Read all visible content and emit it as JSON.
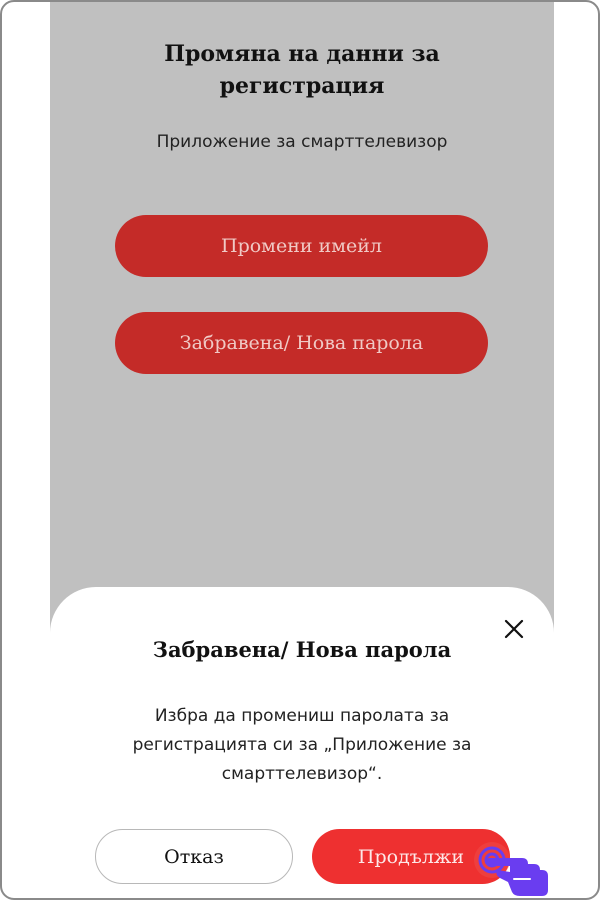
{
  "page": {
    "title": "Промяна на данни за регистрация",
    "subtitle": "Приложение за смарттелевизор",
    "change_email_label": "Промени имейл",
    "forgot_password_label": "Забравена/ Нова парола"
  },
  "dialog": {
    "title": "Забравена/ Нова парола",
    "message": "Избра да промениш паролата за регистрацията си за „Приложение за смарттелевизор“.",
    "cancel_label": "Отказ",
    "continue_label": "Продължи",
    "close_icon": "close-icon"
  },
  "colors": {
    "background": "#c0c0c0",
    "primary_button": "#c42b28",
    "continue_button": "#ee3030",
    "tap_hint": "#6a3df0"
  },
  "icons": {
    "tap_hint": "hand-pointer-icon"
  }
}
